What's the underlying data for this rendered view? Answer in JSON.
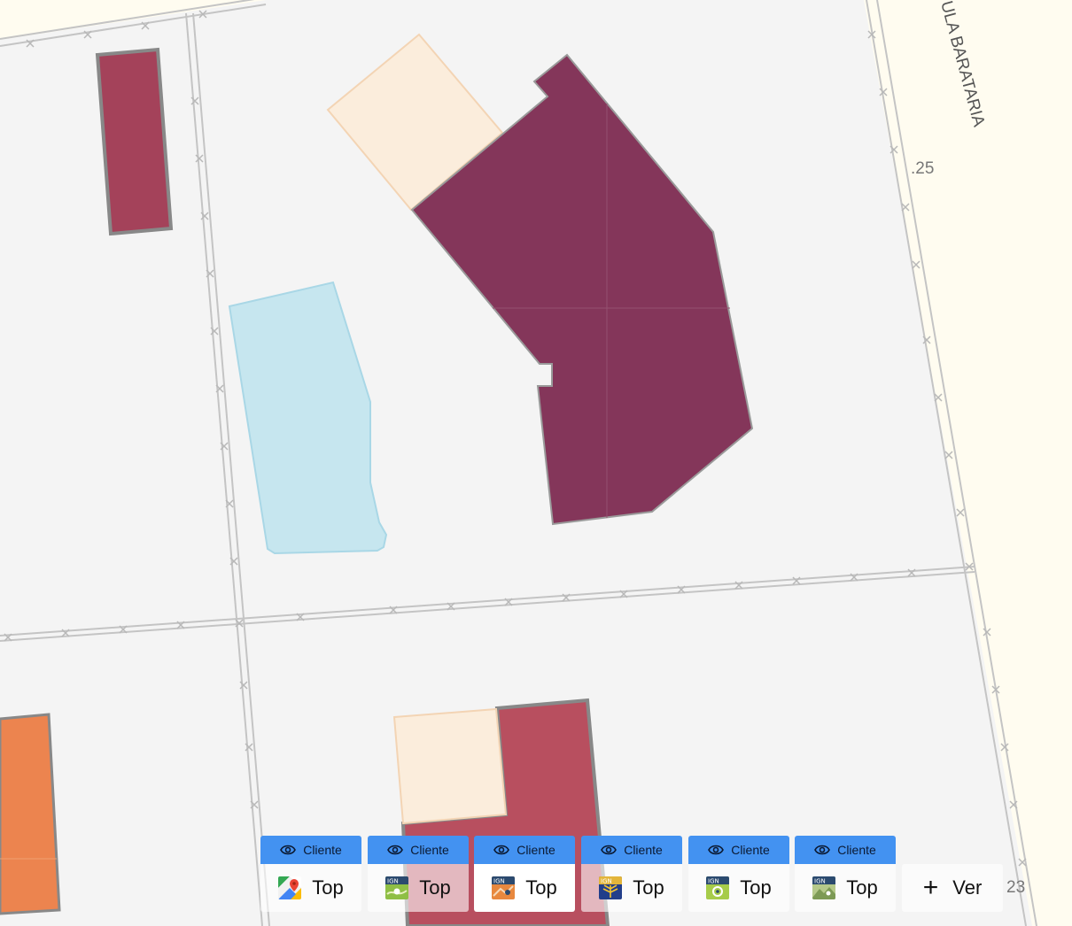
{
  "map": {
    "street_label": "ULA BARATARIA",
    "house_numbers": [
      ".25",
      "23"
    ]
  },
  "layer_switcher": {
    "layers": [
      {
        "visibility_label": "Cliente",
        "label": "Top",
        "icon": "google-maps-icon",
        "active": false
      },
      {
        "visibility_label": "Cliente",
        "label": "Top",
        "icon": "ign-topo-icon",
        "active": false
      },
      {
        "visibility_label": "Cliente",
        "label": "Top",
        "icon": "ign-orange-map-icon",
        "active": true
      },
      {
        "visibility_label": "Cliente",
        "label": "Top",
        "icon": "ign-camino-icon",
        "active": false
      },
      {
        "visibility_label": "Cliente",
        "label": "Top",
        "icon": "ign-green-map-icon",
        "active": false
      },
      {
        "visibility_label": "Cliente",
        "label": "Top",
        "icon": "ign-terrain-icon",
        "active": false
      }
    ],
    "more_label": "Ver"
  },
  "colors": {
    "building_dark": "#84365a",
    "building_red": "#a4425a",
    "building_orange": "#ec844f",
    "annex": "#fbeddc",
    "pool": "#c6e6ef",
    "parcel": "#f4f4f4",
    "road": "#fffcf0",
    "button_accent": "#4392f1"
  }
}
